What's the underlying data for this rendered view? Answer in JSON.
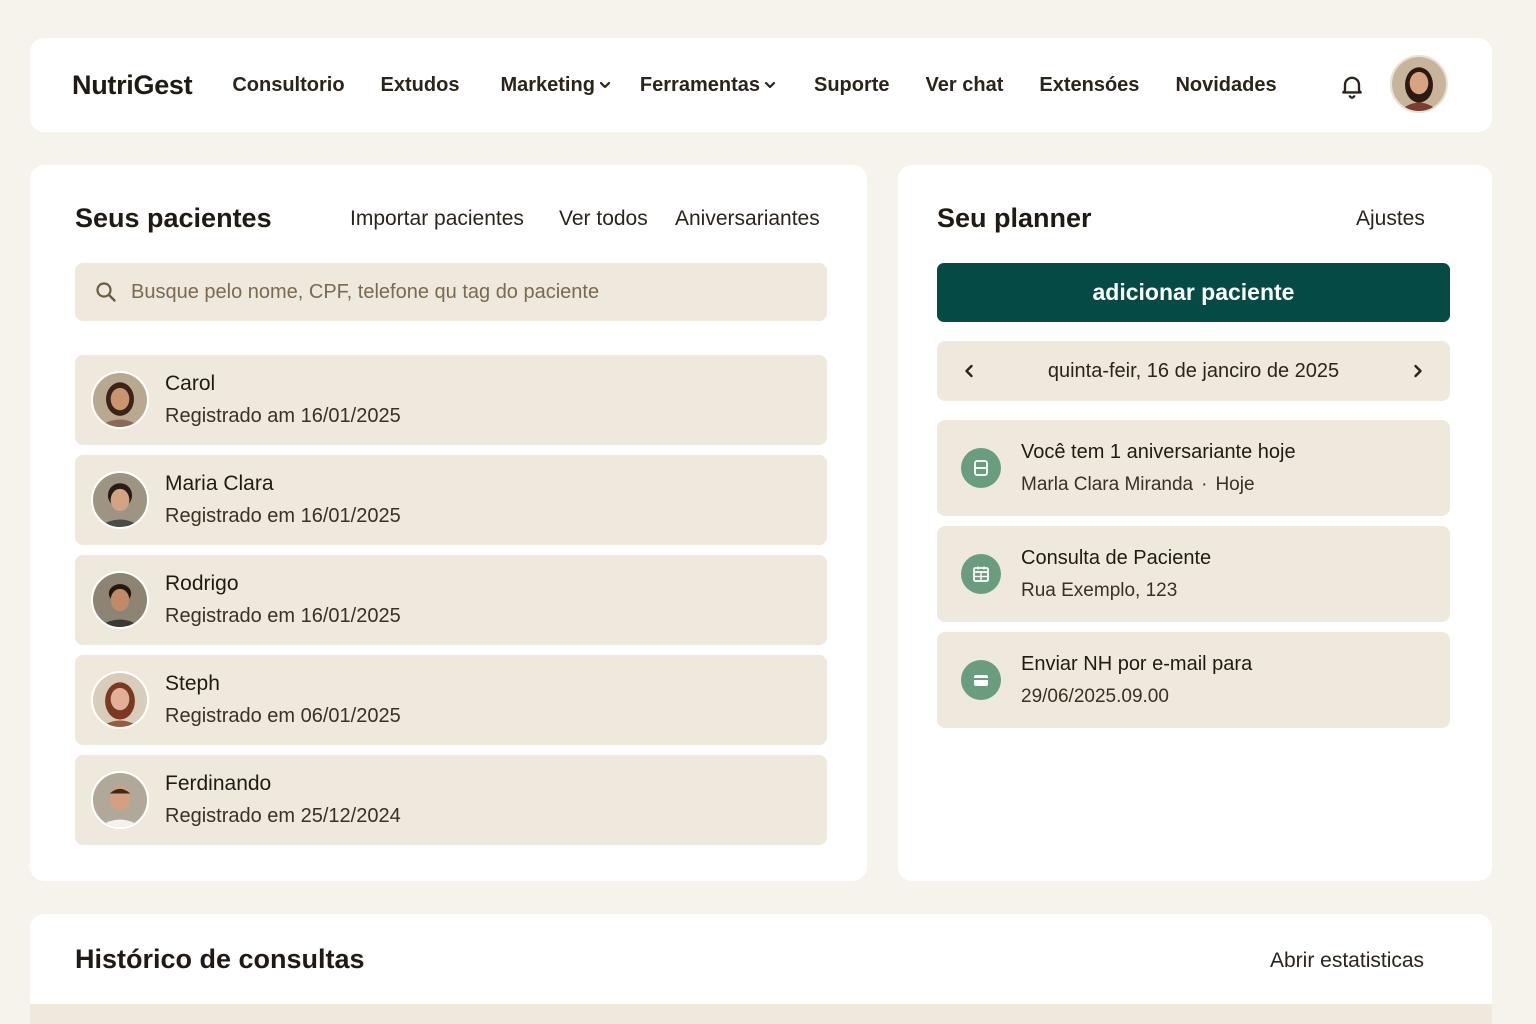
{
  "brand": "NutriGest",
  "nav": {
    "items": [
      {
        "label": "Consultorio",
        "dropdown": false
      },
      {
        "label": "Extudos",
        "dropdown": false
      },
      {
        "label": "Marketing",
        "dropdown": true
      },
      {
        "label": "Ferramentas",
        "dropdown": true
      },
      {
        "label": "Suporte",
        "dropdown": false
      },
      {
        "label": "Ver chat",
        "dropdown": false
      },
      {
        "label": "Extensóes",
        "dropdown": false
      },
      {
        "label": "Novidades",
        "dropdown": false
      }
    ],
    "bell_icon": "bell-icon",
    "avatar_icon": "user-avatar"
  },
  "patients": {
    "title": "Seus pacientes",
    "links": {
      "import": "Importar pacientes",
      "view_all": "Ver todos",
      "birthdays": "Aniversariantes"
    },
    "search_placeholder": "Busque pelo nome, CPF, telefone qu tag do paciente",
    "list": [
      {
        "name": "Carol",
        "registered": "Registrado am 16/01/2025"
      },
      {
        "name": "Maria Clara",
        "registered": "Registrado em 16/01/2025"
      },
      {
        "name": "Rodrigo",
        "registered": "Registrado em 16/01/2025"
      },
      {
        "name": "Steph",
        "registered": "Registrado em 06/01/2025"
      },
      {
        "name": "Ferdinando",
        "registered": "Registrado em 25/12/2024"
      }
    ]
  },
  "planner": {
    "title": "Seu planner",
    "settings": "Ajustes",
    "add_button": "adicionar paciente",
    "date": "quinta-feir, 16 de janciro de 2025",
    "events": [
      {
        "icon": "card-icon",
        "title": "Você tem 1 aniversariante hoje",
        "sub": "Marla Clara Miranda",
        "sub2": "Hoje"
      },
      {
        "icon": "calendar-icon",
        "title": "Consulta de Paciente",
        "sub": "Rua Exemplo, 123",
        "sub2": ""
      },
      {
        "icon": "wallet-icon",
        "title": "Enviar NH por e-mail para",
        "sub": "29/06/2025.09.00",
        "sub2": ""
      }
    ]
  },
  "history": {
    "title": "Histórico de consultas",
    "stats_link": "Abrir estatisticas"
  },
  "colors": {
    "accent": "#054a44",
    "icon_green": "#6a9c80",
    "card_bg": "#efe9dd",
    "page_bg": "#f6f3ec"
  }
}
